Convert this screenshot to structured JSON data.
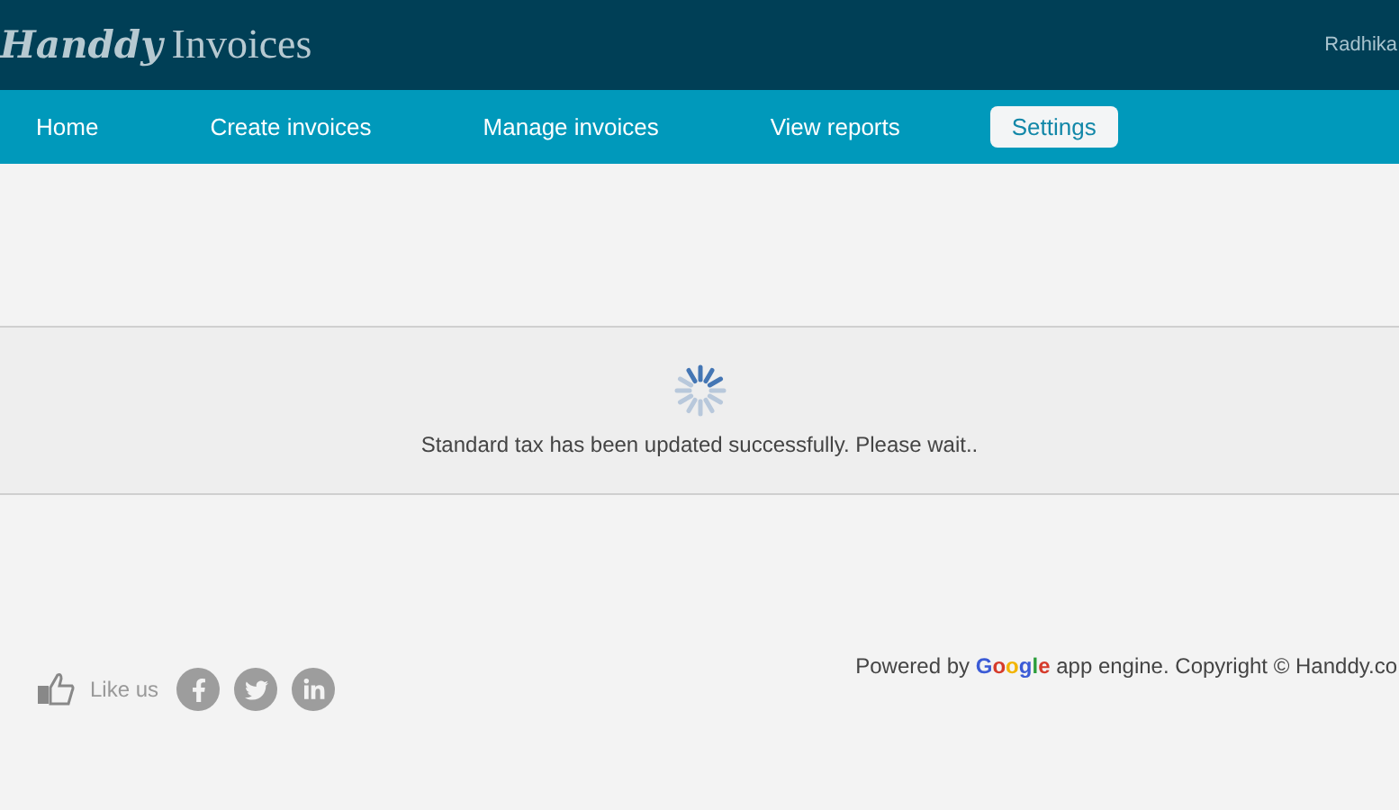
{
  "header": {
    "logo_script": "Handdy",
    "logo_text": "Invoices",
    "user": "Radhika"
  },
  "nav": [
    {
      "label": "Home",
      "selected": false
    },
    {
      "label": "Create invoices",
      "selected": false
    },
    {
      "label": "Manage invoices",
      "selected": false
    },
    {
      "label": "View reports",
      "selected": false
    },
    {
      "label": "Settings",
      "selected": true
    }
  ],
  "notice": {
    "message": "Standard tax has been updated successfully. Please wait.."
  },
  "footer": {
    "like": "Like us",
    "powered_prefix": "Powered by",
    "powered_brand": "Google",
    "powered_suffix": "app engine. Copyright © Handdy.co"
  }
}
